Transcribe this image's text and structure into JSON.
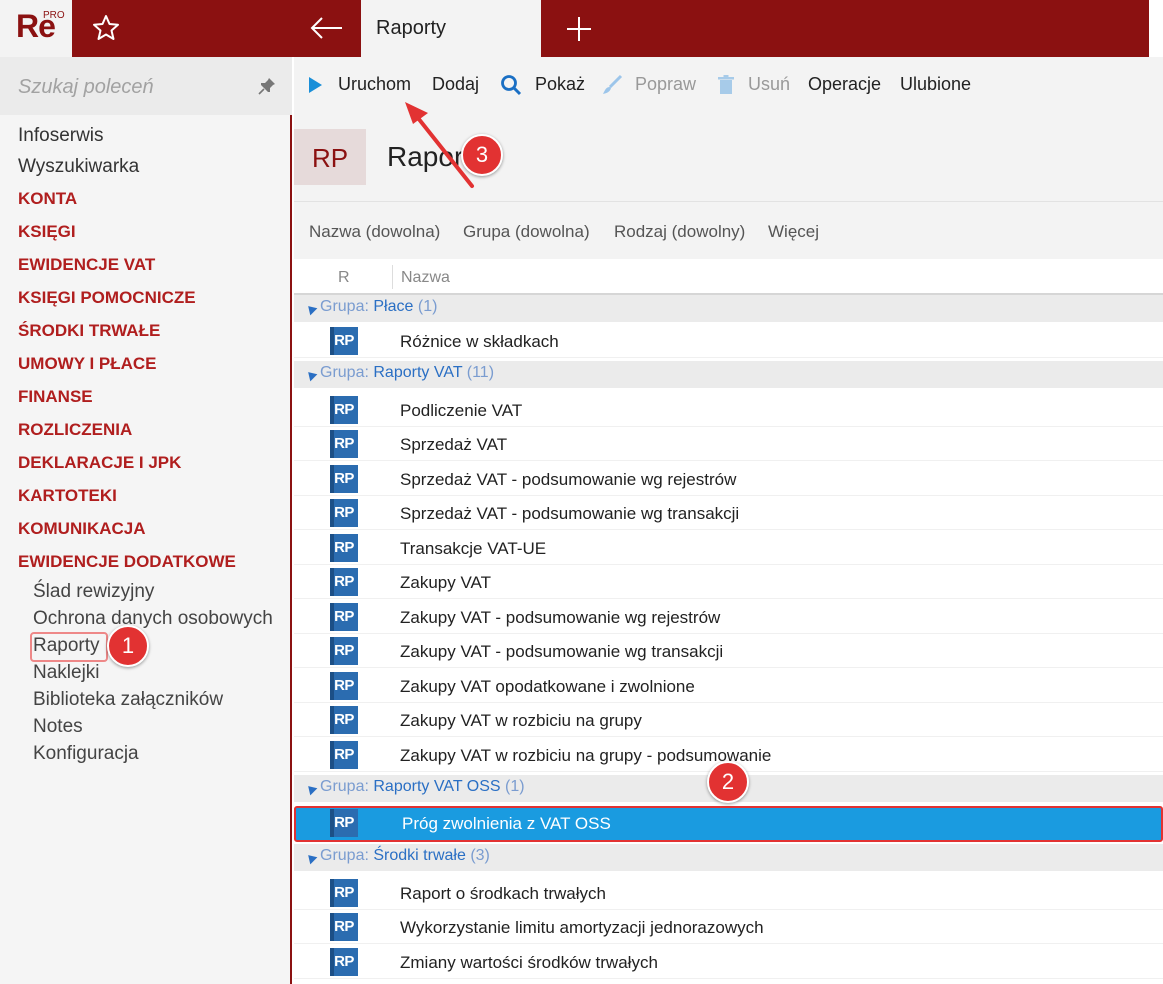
{
  "app": {
    "logo_text": "Re",
    "logo_badge": "PRO"
  },
  "tabs": {
    "active_label": "Raporty"
  },
  "search": {
    "placeholder": "Szukaj poleceń"
  },
  "sidebar": {
    "items": [
      "Infoserwis",
      "Wyszukiwarka"
    ],
    "categories": [
      "KONTA",
      "KSIĘGI",
      "EWIDENCJE VAT",
      "KSIĘGI POMOCNICZE",
      "ŚRODKI TRWAŁE",
      "UMOWY I PŁACE",
      "FINANSE",
      "ROZLICZENIA",
      "DEKLARACJE I JPK",
      "KARTOTEKI",
      "KOMUNIKACJA",
      "EWIDENCJE DODATKOWE"
    ],
    "subitems": [
      "Ślad rewizyjny",
      "Ochrona danych osobowych",
      "Raporty",
      "Naklejki",
      "Biblioteka załączników",
      "Notes",
      "Konfiguracja"
    ]
  },
  "toolbar": {
    "run": "Uruchom",
    "add": "Dodaj",
    "show": "Pokaż",
    "edit": "Popraw",
    "delete": "Usuń",
    "operations": "Operacje",
    "favorites": "Ulubione"
  },
  "header": {
    "badge": "RP",
    "title": "Raporty"
  },
  "filters": [
    "Nazwa (dowolna)",
    "Grupa (dowolna)",
    "Rodzaj (dowolny)",
    "Więcej"
  ],
  "columns": {
    "r": "R",
    "name": "Nazwa"
  },
  "groups": [
    {
      "label": "Grupa:",
      "name": "Płace",
      "count": "(1)",
      "rows": [
        "Różnice w składkach"
      ]
    },
    {
      "label": "Grupa:",
      "name": "Raporty VAT",
      "count": "(11)",
      "rows": [
        "Podliczenie VAT",
        "Sprzedaż VAT",
        "Sprzedaż VAT - podsumowanie wg rejestrów",
        "Sprzedaż VAT - podsumowanie wg transakcji",
        "Transakcje VAT-UE",
        "Zakupy VAT",
        "Zakupy VAT - podsumowanie wg rejestrów",
        "Zakupy VAT - podsumowanie wg transakcji",
        "Zakupy VAT opodatkowane i zwolnione",
        "Zakupy VAT w rozbiciu na grupy",
        "Zakupy VAT w rozbiciu na grupy - podsumowanie"
      ]
    },
    {
      "label": "Grupa:",
      "name": "Raporty VAT OSS",
      "count": "(1)",
      "rows": [
        "Próg zwolnienia z VAT OSS"
      ]
    },
    {
      "label": "Grupa:",
      "name": "Środki trwałe",
      "count": "(3)",
      "rows": [
        "Raport o środkach trwałych",
        "Wykorzystanie limitu amortyzacji jednorazowych",
        "Zmiany wartości środków trwałych"
      ]
    }
  ],
  "row_icon": "RP",
  "callouts": [
    "1",
    "2",
    "3"
  ],
  "colors": {
    "brand": "#8b1111",
    "accent": "#b01e1e",
    "selection": "#1a9be0",
    "callout": "#e23232",
    "link": "#2a6fc4"
  }
}
